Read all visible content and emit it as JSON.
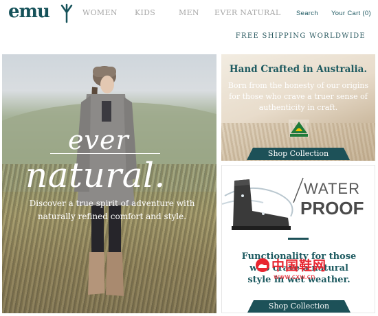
{
  "header": {
    "logo_text": "emu",
    "nav": [
      "WOMEN",
      "KIDS",
      "MEN",
      "EVER NATURAL"
    ],
    "search_label": "Search",
    "cart_label": "Your Cart (0)",
    "shipping_banner": "FREE SHIPPING WORLDWIDE"
  },
  "hero": {
    "script_line1": "ever",
    "script_line2": "natural.",
    "copy": "Discover a true spirit of adventure with naturally refined comfort and style."
  },
  "promo_australia": {
    "title": "Hand Crafted in Australia.",
    "body": "Born from the honesty of our origins for those who crave a truer sense of authenticity in craft.",
    "badge_text": "AUSTRALIAN MADE",
    "button": "Shop Collection"
  },
  "promo_waterproof": {
    "headline_top": "WATER",
    "headline_bottom": "PROOF",
    "title": "Functionality for those who crave a natural style in wet weather.",
    "button": "Shop Collection"
  },
  "watermark": {
    "text": "中国鞋网",
    "url": "www.cxw.cn"
  },
  "colors": {
    "brand_teal": "#1d5158",
    "nav_grey": "#a7a7a7",
    "watermark_red": "#e82530"
  }
}
